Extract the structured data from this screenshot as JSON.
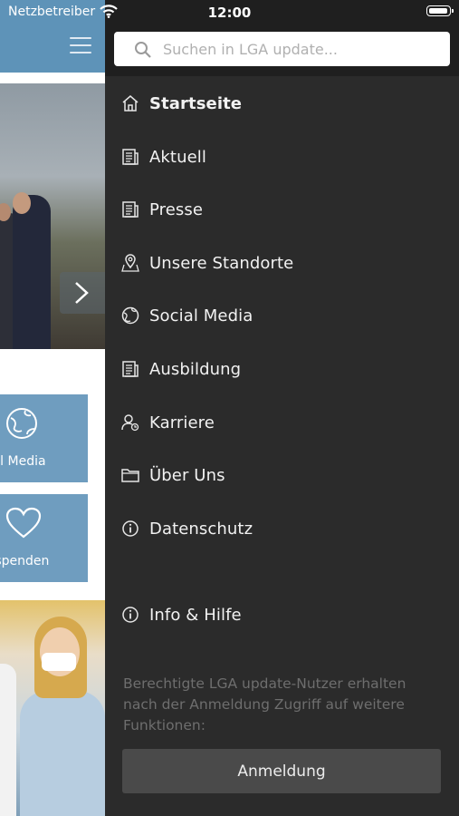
{
  "status_bar": {
    "carrier": "Netzbetreiber",
    "time": "12:00",
    "battery_level": 1.0
  },
  "background_app": {
    "tiles": [
      {
        "label": "cial Media",
        "icon": "globe-icon"
      },
      {
        "label": "utspenden",
        "icon": "heart-icon"
      }
    ],
    "colors": {
      "header": "#5e93b8",
      "tile": "#6f9dbf"
    }
  },
  "drawer": {
    "search": {
      "placeholder": "Suchen in LGA update..."
    },
    "menu": [
      {
        "label": "Startseite",
        "icon": "home-icon",
        "active": true
      },
      {
        "label": "Aktuell",
        "icon": "news-icon"
      },
      {
        "label": "Presse",
        "icon": "news-icon"
      },
      {
        "label": "Unsere Standorte",
        "icon": "map-pin-icon"
      },
      {
        "label": "Social Media",
        "icon": "globe-icon"
      },
      {
        "label": "Ausbildung",
        "icon": "news-icon"
      },
      {
        "label": "Karriere",
        "icon": "person-icon"
      },
      {
        "label": "Über Uns",
        "icon": "folder-icon"
      },
      {
        "label": "Datenschutz",
        "icon": "info-icon"
      },
      {
        "label": "Info & Hilfe",
        "icon": "info-icon"
      }
    ],
    "note": "Berechtigte LGA update-Nutzer erhalten nach der Anmeldung Zugriff auf weitere Funktionen:",
    "login_label": "Anmeldung",
    "colors": {
      "background": "#2b2b2b",
      "text": "#f2f2f2",
      "button": "#4a4a4a"
    }
  }
}
